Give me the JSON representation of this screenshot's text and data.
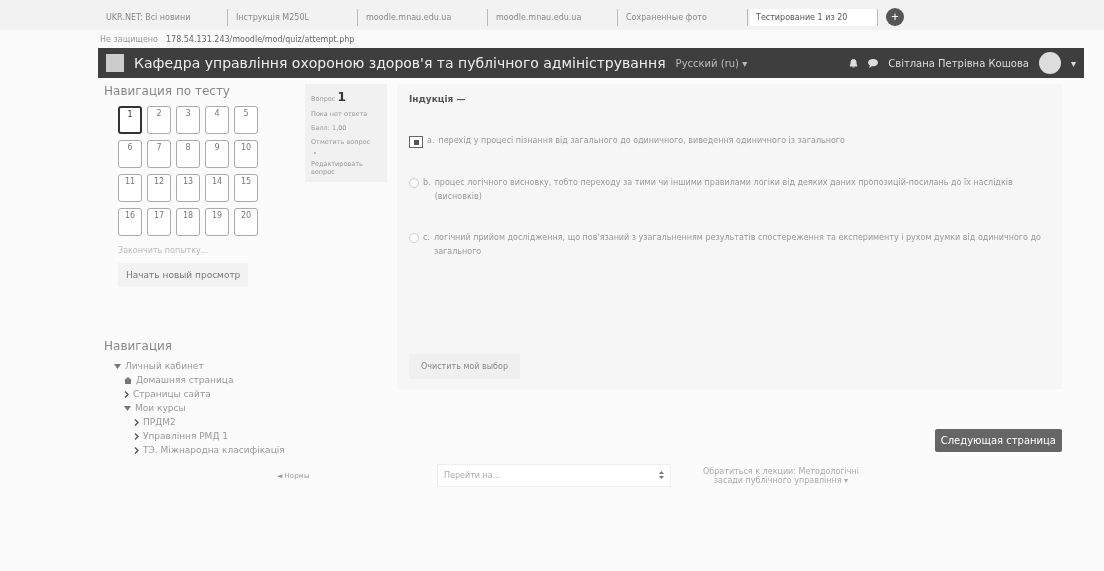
{
  "browser": {
    "tabs": [
      {
        "label": "UKR.NET: Всі новини",
        "selected": false
      },
      {
        "label": "Інструкція M250L",
        "selected": false
      },
      {
        "label": "moodle.mnau.edu.ua",
        "selected": false
      },
      {
        "label": "moodle.mnau.edu.ua",
        "selected": false
      },
      {
        "label": "Сохраненные фото",
        "selected": false
      },
      {
        "label": "Тестирование 1 из 20",
        "selected": true
      }
    ],
    "new_tab": "+",
    "security": "Не защищено",
    "url": "178.54.131.243/moodle/mod/quiz/attempt.php"
  },
  "navbar": {
    "title": "Кафедра управління охороною здоров'я та публічного адміністрування",
    "language": "Русский (ru) ▾",
    "user": "Світлана Петрівна Кошова",
    "menu_caret": "▾"
  },
  "quiz_nav": {
    "title": "Навигация по тесту",
    "buttons": [
      {
        "label": "1",
        "selected": true
      },
      {
        "label": "2",
        "selected": false
      },
      {
        "label": "3",
        "selected": false
      },
      {
        "label": "4",
        "selected": false
      },
      {
        "label": "5",
        "selected": false
      },
      {
        "label": "6",
        "selected": false
      },
      {
        "label": "7",
        "selected": false
      },
      {
        "label": "8",
        "selected": false
      },
      {
        "label": "9",
        "selected": false
      },
      {
        "label": "10",
        "selected": false
      },
      {
        "label": "11",
        "selected": false
      },
      {
        "label": "12",
        "selected": false
      },
      {
        "label": "13",
        "selected": false
      },
      {
        "label": "14",
        "selected": false
      },
      {
        "label": "15",
        "selected": false
      },
      {
        "label": "16",
        "selected": false
      },
      {
        "label": "17",
        "selected": false
      },
      {
        "label": "18",
        "selected": false
      },
      {
        "label": "19",
        "selected": false
      },
      {
        "label": "20",
        "selected": false
      }
    ],
    "finish_link": "Закончить попытку...",
    "restart_button": "Начать новый просмотр"
  },
  "navigation": {
    "title": "Навигация",
    "items": [
      {
        "label": "Личный кабинет",
        "kind": "branch",
        "expanded": true,
        "children": [
          {
            "label": "Домашняя страница",
            "kind": "home"
          },
          {
            "label": "Страницы сайта",
            "kind": "branch",
            "expanded": false
          },
          {
            "label": "Мои курсы",
            "kind": "branch",
            "expanded": true,
            "children": [
              {
                "label": "ПРДМ2",
                "kind": "branch",
                "expanded": false
              },
              {
                "label": "Управління РМД 1",
                "kind": "branch",
                "expanded": false
              },
              {
                "label": "ТЭ. Міжнародна класифікація",
                "kind": "branch",
                "expanded": false
              }
            ]
          }
        ]
      }
    ]
  },
  "question_info": {
    "label": "Вопрос",
    "number": "1",
    "status": "Пока нет ответа",
    "grade": "Балл: 1,00",
    "flag": "Отметить вопрос",
    "edit": "Редактировать вопрос"
  },
  "question": {
    "text": "Індукція —",
    "answers": [
      {
        "letter": "a.",
        "text": "перехід у процесі пізнання від загального до одиничного, виведення одиничного із загального",
        "selected": true
      },
      {
        "letter": "b.",
        "text": "процес логічного висновку, тобто переходу за тими чи іншими правилами логіки від деяких даних пропозицій-посилань до їх наслідків (висновків)",
        "selected": false
      },
      {
        "letter": "c.",
        "text": "логічний прийом дослідження, що пов'язаний з узагальненням результатів спостереження та експерименту і рухом думки від одиничного до загального",
        "selected": false
      }
    ],
    "clear_link": "Очистить мой выбор"
  },
  "next_button": "Следующая страница",
  "footer": {
    "prev_link": "◄ Нормы",
    "jump_select": "Перейти на...",
    "next_link": "Обратиться к лекции: Методологічні засади публічного управління ▾"
  }
}
